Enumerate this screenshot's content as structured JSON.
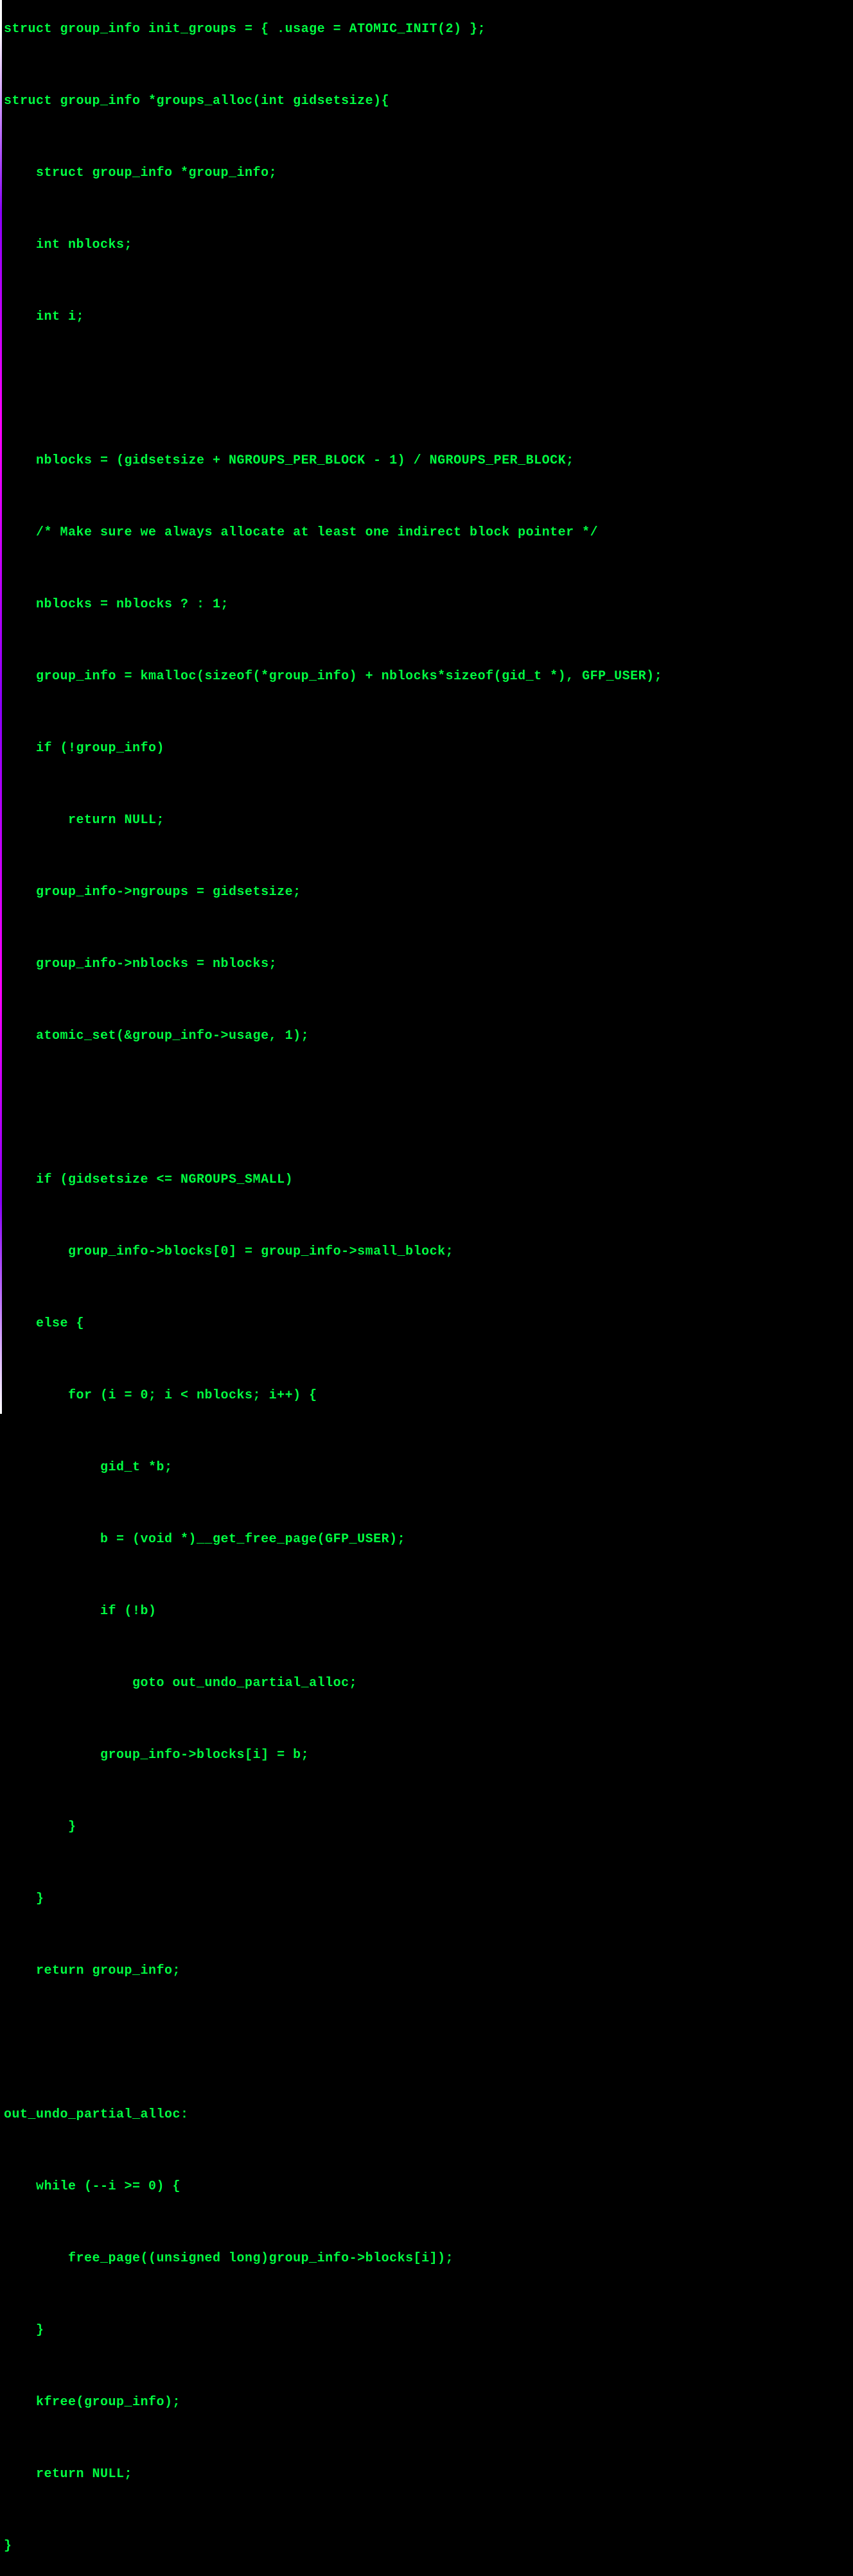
{
  "code": {
    "lines": [
      "struct group_info init_groups = { .usage = ATOMIC_INIT(2) };",
      "",
      "struct group_info *groups_alloc(int gidsetsize){",
      "",
      "    struct group_info *group_info;",
      "",
      "    int nblocks;",
      "",
      "    int i;",
      "",
      "",
      "",
      "    nblocks = (gidsetsize + NGROUPS_PER_BLOCK - 1) / NGROUPS_PER_BLOCK;",
      "",
      "    /* Make sure we always allocate at least one indirect block pointer */",
      "",
      "    nblocks = nblocks ? : 1;",
      "",
      "    group_info = kmalloc(sizeof(*group_info) + nblocks*sizeof(gid_t *), GFP_USER);",
      "",
      "    if (!group_info)",
      "",
      "        return NULL;",
      "",
      "    group_info->ngroups = gidsetsize;",
      "",
      "    group_info->nblocks = nblocks;",
      "",
      "    atomic_set(&group_info->usage, 1);",
      "",
      "",
      "",
      "    if (gidsetsize <= NGROUPS_SMALL)",
      "",
      "        group_info->blocks[0] = group_info->small_block;",
      "",
      "    else {",
      "",
      "        for (i = 0; i < nblocks; i++) {",
      "",
      "            gid_t *b;",
      "",
      "            b = (void *)__get_free_page(GFP_USER);",
      "",
      "            if (!b)",
      "",
      "                goto out_undo_partial_alloc;",
      "",
      "            group_info->blocks[i] = b;",
      "",
      "        }",
      "",
      "    }",
      "",
      "    return group_info;",
      "",
      "",
      "",
      "out_undo_partial_alloc:",
      "",
      "    while (--i >= 0) {",
      "",
      "        free_page((unsigned long)group_info->blocks[i]);",
      "",
      "    }",
      "",
      "    kfree(group_info);",
      "",
      "    return NULL;",
      "",
      "}"
    ]
  }
}
